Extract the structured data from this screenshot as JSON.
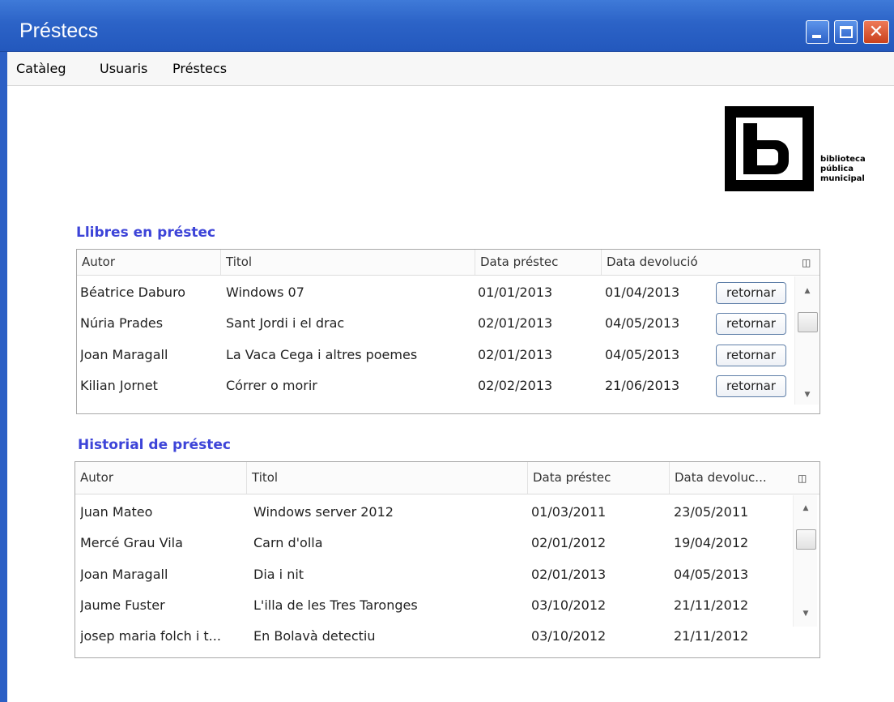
{
  "window": {
    "title": "Préstecs"
  },
  "menu": [
    "Catàleg",
    "Usuaris",
    "Préstecs"
  ],
  "logo": {
    "lines": [
      "biblioteca",
      "pública",
      "municipal"
    ]
  },
  "loans": {
    "title": "Llibres en préstec",
    "columns": [
      "Autor",
      "Titol",
      "Data préstec",
      "Data devolució"
    ],
    "rows": [
      {
        "author": "Béatrice Daburo",
        "title": "Windows 07",
        "loan_date": "01/01/2013",
        "return_date": "01/04/2013",
        "action": "retornar"
      },
      {
        "author": "Núria Prades",
        "title": "Sant Jordi i el drac",
        "loan_date": "02/01/2013",
        "return_date": "04/05/2013",
        "action": "retornar"
      },
      {
        "author": "Joan Maragall",
        "title": "La Vaca Cega i altres poemes",
        "loan_date": "02/01/2013",
        "return_date": "04/05/2013",
        "action": "retornar"
      },
      {
        "author": "Kilian Jornet",
        "title": "Córrer o morir",
        "loan_date": "02/02/2013",
        "return_date": "21/06/2013",
        "action": "retornar"
      }
    ]
  },
  "history": {
    "title": "Historial de préstec",
    "columns": [
      "Autor",
      "Titol",
      "Data préstec",
      "Data devoluc..."
    ],
    "rows": [
      {
        "author": "Juan Mateo",
        "title": "Windows server 2012",
        "loan_date": "01/03/2011",
        "return_date": "23/05/2011"
      },
      {
        "author": "Mercé Grau Vila",
        "title": "Carn d'olla",
        "loan_date": "02/01/2012",
        "return_date": "19/04/2012"
      },
      {
        "author": "Joan Maragall",
        "title": "Dia i nit",
        "loan_date": "02/01/2013",
        "return_date": "04/05/2013"
      },
      {
        "author": "Jaume Fuster",
        "title": "L'illa de les Tres Taronges",
        "loan_date": "03/10/2012",
        "return_date": "21/11/2012"
      },
      {
        "author": "josep maria folch i t...",
        "title": "En Bolavà detectiu",
        "loan_date": "03/10/2012",
        "return_date": "21/11/2012"
      }
    ]
  },
  "colors": {
    "titlebar": "#2c63c7",
    "section_title": "#3d44d8",
    "close_button": "#d9542f"
  },
  "icons": [
    "minimize-icon",
    "maximize-icon",
    "close-icon",
    "column-chooser-icon",
    "scroll-up-icon",
    "scroll-down-icon"
  ]
}
